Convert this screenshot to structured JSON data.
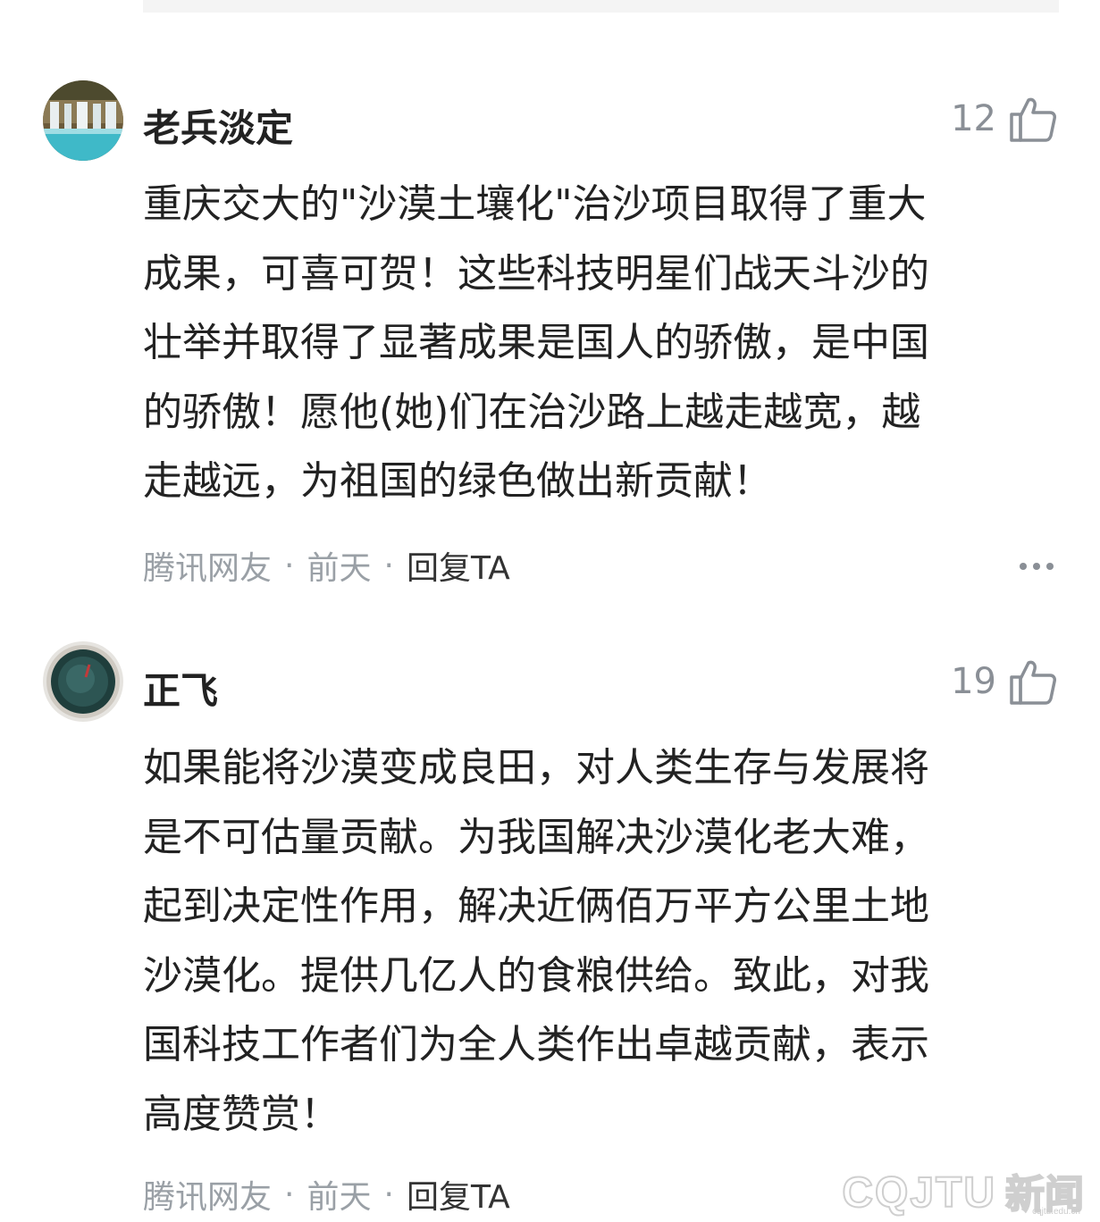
{
  "comments": [
    {
      "username": "老兵淡定",
      "likes": "12",
      "lines": [
        "重庆交大的\"沙漠土壤化\"治沙项目取得了重大",
        "成果，可喜可贺！这些科技明星们战天斗沙的",
        "壮举并取得了显著成果是国人的骄傲，是中国",
        "的骄傲！愿他(她)们在治沙路上越走越宽，越",
        "走越远，为祖国的绿色做出新贡献！"
      ],
      "source": "腾讯网友",
      "time": "前天",
      "reply_label": "回复TA",
      "separator": "·"
    },
    {
      "username": "正飞",
      "likes": "19",
      "lines": [
        "如果能将沙漠变成良田，对人类生存与发展将",
        "是不可估量贡献。为我国解决沙漠化老大难，",
        "起到决定性作用，解决近俩佰万平方公里土地",
        "沙漠化。提供几亿人的食粮供给。致此，对我",
        "国科技工作者们为全人类作出卓越贡献，表示",
        "高度赞赏！"
      ],
      "source": "腾讯网友",
      "time": "前天",
      "reply_label": "回复TA",
      "separator": "·"
    }
  ],
  "watermark": {
    "logo": "CQJTU",
    "text": "新闻",
    "small": "cqjtu.edu.cn"
  },
  "icons": {
    "like": "thumbs-up-icon",
    "more": "more-dots-icon"
  },
  "colors": {
    "text": "#222222",
    "meta": "#9aa0a6",
    "likes": "#8a8f96"
  }
}
